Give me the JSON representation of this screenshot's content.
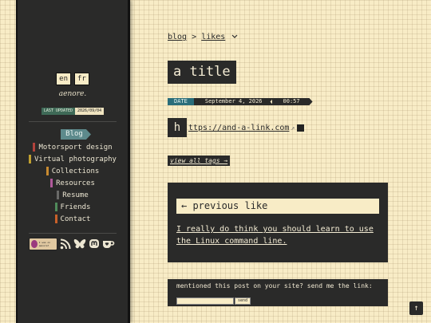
{
  "sidebar": {
    "languages": [
      "en",
      "fr"
    ],
    "site_title": "aenore.",
    "last_updated_label": "LAST UPDATED",
    "last_updated_date": "2026/09/04",
    "current_section": "Blog",
    "nav": [
      {
        "label": "Motorsport design",
        "color": "#b3433c"
      },
      {
        "label": "Virtual photography",
        "color": "#c0a030"
      },
      {
        "label": "Collections",
        "color": "#c88a30"
      },
      {
        "label": "Resources",
        "color": "#b05a9a"
      },
      {
        "label": "Resume",
        "color": "#6a6a68"
      },
      {
        "label": "Friends",
        "color": "#4f8a5a"
      },
      {
        "label": "Contact",
        "color": "#c8602a"
      }
    ],
    "coast_badge_text": "I was on aenore?",
    "social_icons": [
      "rss-icon",
      "bluesky-icon",
      "mastodon-icon",
      "kofi-icon"
    ]
  },
  "breadcrumb": {
    "blog": "blog",
    "sep": ">",
    "current": "likes"
  },
  "post": {
    "title": "a title",
    "date_label": "DATE",
    "date": "September 4, 2026",
    "time": "00:57",
    "link_initial": "h",
    "link_url": "ttps://and-a-link.com",
    "ext_glyph": "↗",
    "tags_button": "view all tags →"
  },
  "previous": {
    "heading": "← previous like",
    "text": "I really do think you should learn to use the Linux command line."
  },
  "mention": {
    "prompt": "mentioned this post on your site? send me the link:",
    "send_label": "send"
  },
  "to_top": "↑"
}
